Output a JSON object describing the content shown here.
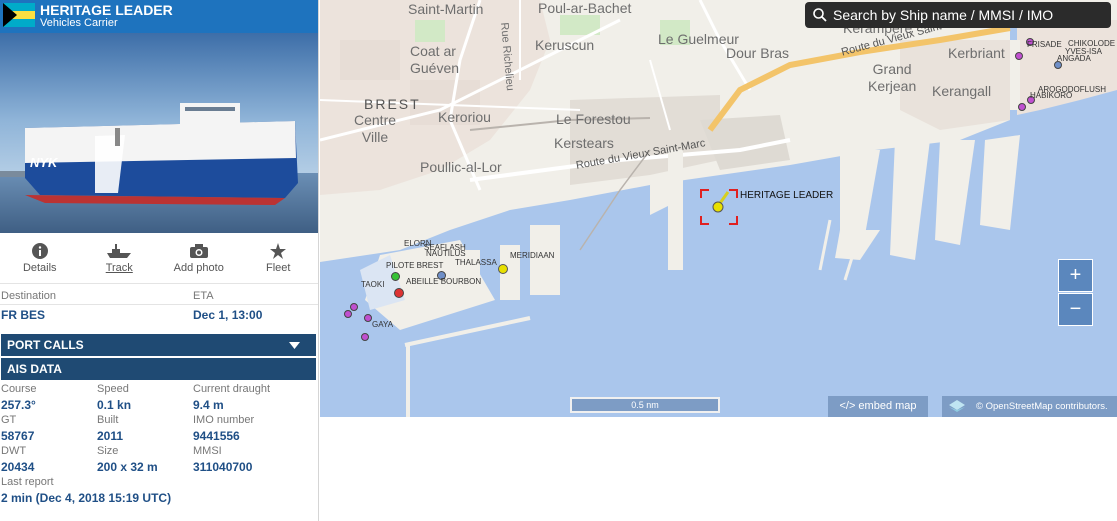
{
  "vessel": {
    "name": "HERITAGE LEADER",
    "type": "Vehicles Carrier",
    "hull_text": "NYK"
  },
  "actions": [
    {
      "label": "Details",
      "icon": "info-icon"
    },
    {
      "label": "Track",
      "icon": "ship-icon"
    },
    {
      "label": "Add photo",
      "icon": "camera-icon"
    },
    {
      "label": "Fleet",
      "icon": "star-icon"
    }
  ],
  "voyage": {
    "destination_label": "Destination",
    "destination": "FR BES",
    "eta_label": "ETA",
    "eta": "Dec 1, 13:00"
  },
  "sections": {
    "port_calls": "PORT CALLS",
    "ais_data": "AIS DATA"
  },
  "ais": {
    "course_label": "Course",
    "course": "257.3°",
    "speed_label": "Speed",
    "speed": "0.1 kn",
    "draught_label": "Current draught",
    "draught": "9.4 m",
    "gt_label": "GT",
    "gt": "58767",
    "built_label": "Built",
    "built": "2011",
    "imo_label": "IMO number",
    "imo": "9441556",
    "dwt_label": "DWT",
    "dwt": "20434",
    "size_label": "Size",
    "size": "200 x 32 m",
    "mmsi_label": "MMSI",
    "mmsi": "311040700",
    "last_report_label": "Last report",
    "last_report": "2 min (Dec 4, 2018 15:19 UTC)"
  },
  "map": {
    "search_placeholder": "Search by Ship name / MMSI / IMO",
    "zoom_in": "+",
    "zoom_out": "−",
    "scale": "0.5 nm",
    "embed": "</> embed map",
    "attribution": "© OpenStreetMap contributors.",
    "place_labels": {
      "saint_martin": "Saint-Martin",
      "poul_ar_bachet": "Poul-ar-Bachet",
      "coat_ar_gueven": "Coat ar\nGuéven",
      "keruscun": "Keruscun",
      "le_guelmeur": "Le Guelmeur",
      "dour_bras": "Dour Bras",
      "kerampere": "Kerampere",
      "kerbriant": "Kerbriant",
      "rue_richelieu": "Rue Richelieu",
      "route_vieux_st_marc_upper": "Route du Vieux Saint-",
      "grand_kerjean": "Grand\nKerjean",
      "kerangall": "Kerangall",
      "brest": "BREST",
      "centre_ville": "Centre\nVille",
      "keroriou": "Keroriou",
      "le_forestou": "Le Forestou",
      "kerstears": "Kerstears",
      "route_vieux_st_marc_lower": "Route du Vieux Saint-Marc",
      "poullic_al_lor": "Poullic-al-Lor"
    },
    "vessels": [
      {
        "name": "HERITAGE LEADER",
        "color": "#e8e000"
      },
      {
        "name": "MERIDIAAN",
        "color": "#e8e000"
      },
      {
        "name": "ELORN",
        "color": "#8aa6d6"
      },
      {
        "name": "SEAFLASH",
        "color": "#8aa6d6"
      },
      {
        "name": "NAUTILUS",
        "color": "#8aa6d6"
      },
      {
        "name": "PILOTE BREST",
        "color": "#36c236"
      },
      {
        "name": "THALASSA",
        "color": "#8aa6d6"
      },
      {
        "name": "ABEILLE BOURBON",
        "color": "#6f8fc8"
      },
      {
        "name": "TAOKI",
        "color": "#8aa6d6"
      },
      {
        "name": "GAYA",
        "color": "#c050d0"
      },
      {
        "name": "FRISADE",
        "color": "#c050d0"
      },
      {
        "name": "CHIKOLODE",
        "color": "#c050d0"
      },
      {
        "name": "YVES-ISA",
        "color": "#c050d0"
      },
      {
        "name": "ANGADA",
        "color": "#c050d0"
      },
      {
        "name": "AROGODOFLUSH",
        "color": "#c050d0"
      },
      {
        "name": "HABIKORO",
        "color": "#c050d0"
      }
    ]
  }
}
